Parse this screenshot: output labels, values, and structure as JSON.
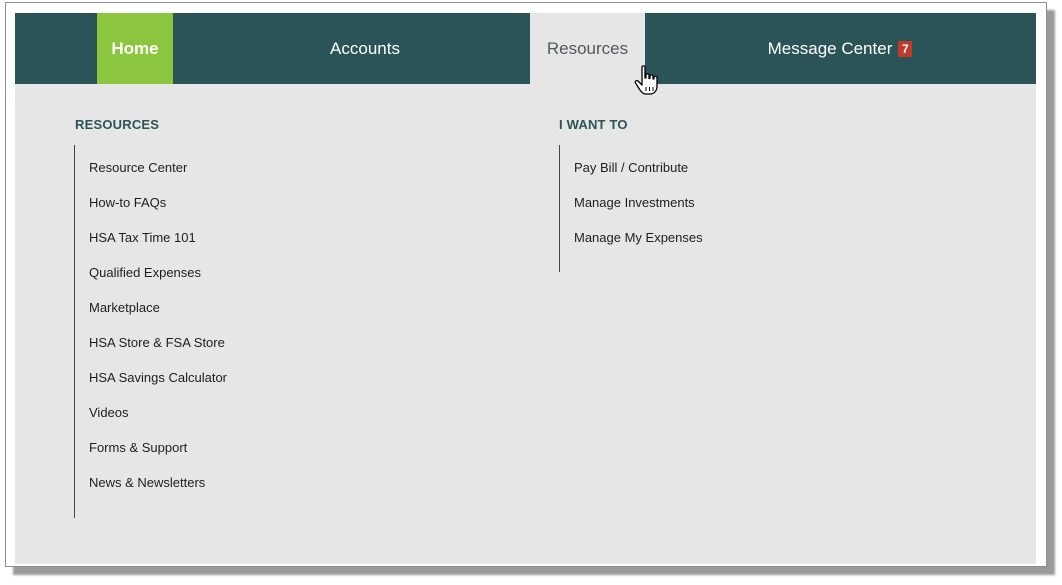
{
  "nav": {
    "home": "Home",
    "accounts": "Accounts",
    "resources": "Resources",
    "message_center": "Message Center",
    "message_count": "7"
  },
  "resources": {
    "title": "RESOURCES",
    "items": [
      "Resource Center",
      "How-to FAQs",
      "HSA Tax Time 101",
      "Qualified Expenses",
      "Marketplace",
      "HSA Store & FSA Store",
      "HSA Savings Calculator",
      "Videos",
      "Forms & Support",
      "News & Newsletters"
    ]
  },
  "i_want_to": {
    "title": "I WANT TO",
    "items": [
      "Pay Bill / Contribute",
      "Manage Investments",
      "Manage My Expenses"
    ]
  },
  "colors": {
    "nav_bg": "#2b5459",
    "home_bg": "#8cc63f",
    "panel_bg": "#e6e6e6",
    "badge_bg": "#c0392b"
  },
  "icons": {
    "cursor": "hand-pointer-icon"
  }
}
